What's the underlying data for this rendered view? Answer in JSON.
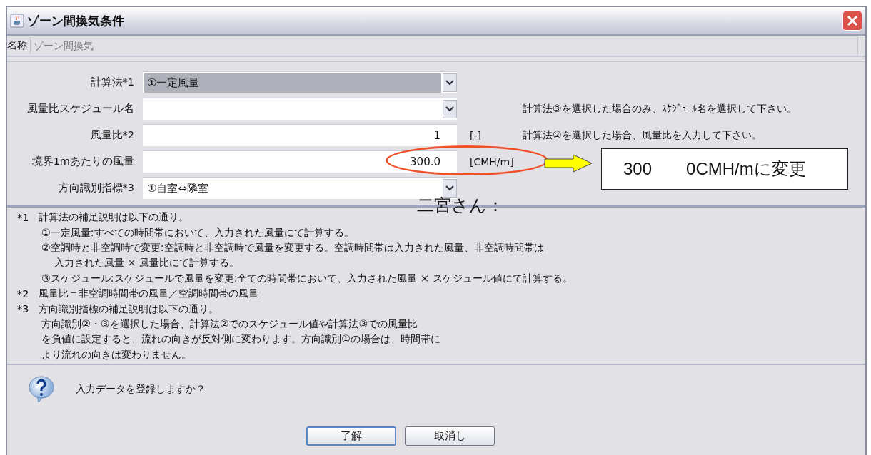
{
  "window": {
    "title": "ゾーン間換気条件"
  },
  "name_row": {
    "label": "名称",
    "value": "ゾーン間換気",
    "disabled": true
  },
  "form_rows": [
    {
      "kind": "combo",
      "label": "計算法*1",
      "value": "①一定風量",
      "focused": true,
      "unit": "",
      "hint": ""
    },
    {
      "kind": "combo",
      "label": "風量比スケジュール名",
      "value": "",
      "focused": false,
      "unit": "",
      "hint": "計算法③を選択した場合のみ、ｽｹｼﾞｭｰﾙ名を選択して下さい。"
    },
    {
      "kind": "text",
      "label": "風量比*2",
      "value": "1",
      "focused": false,
      "unit": "[-]",
      "hint": "計算法②を選択した場合、風量比を入力して下さい。"
    },
    {
      "kind": "text",
      "label": "境界1mあたりの風量",
      "value": "300.0",
      "focused": false,
      "unit": "[CMH/m]",
      "hint": ""
    },
    {
      "kind": "combo",
      "label": "方向識別指標*3",
      "value": "①自室⇔隣室",
      "focused": false,
      "unit": "",
      "hint": ""
    }
  ],
  "notes": [
    {
      "mark": "*1",
      "text": "計算法の補足説明は以下の通り。",
      "children": [
        {
          "text": "①一定風量:すべての時間帯において、入力された風量にて計算する。"
        },
        {
          "text": "②空調時と非空調時で変更:空調時と非空調時で風量を変更する。空調時間帯は入力された風量、非空調時間帯は",
          "children": [
            {
              "text": "入力された風量 × 風量比にて計算する。"
            }
          ]
        },
        {
          "text": "③スケジュール:スケジュールで風量を変更:全ての時間帯において、入力された風量 × スケジュール値にて計算する。"
        }
      ]
    },
    {
      "mark": "*2",
      "text": "風量比＝非空調時間帯の風量／空調時間帯の風量"
    },
    {
      "mark": "*3",
      "text": "方向識別指標の補足説明は以下の通り。",
      "children": [
        {
          "text": "方向識別②・③を選択した場合、計算法②でのスケジュール値や計算法③での風量比"
        },
        {
          "text": "を負値に設定すると、流れの向きが反対側に変わります。方向識別①の場合は、時間帯に"
        },
        {
          "text": "より流れの向きは変わりません。"
        }
      ]
    }
  ],
  "question": "入力データを登録しますか？",
  "buttons": [
    {
      "label": "了解",
      "selected": true
    },
    {
      "label": "取消し",
      "selected": false
    }
  ],
  "annotation": {
    "callout": "300　　0CMH/mに変更",
    "note": "二宮さん："
  }
}
